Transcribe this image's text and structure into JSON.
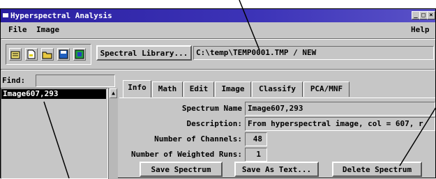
{
  "window": {
    "title": "Hyperspectral Analysis"
  },
  "title_buttons": [
    "_",
    "□",
    "×"
  ],
  "menu": {
    "file": "File",
    "image": "Image",
    "help": "Help"
  },
  "toolbar": {
    "icons": [
      "notebook-icon",
      "new-file-icon",
      "open-folder-icon",
      "save-disk-icon",
      "image-icon"
    ],
    "spectral_library_label": "Spectral Library...",
    "library_path": "C:\\temp\\TEMP0001.TMP / NEW"
  },
  "left_panel": {
    "find_label": "Find:",
    "find_value": "",
    "list_items": [
      "Image607,293"
    ]
  },
  "tabs": [
    "Info",
    "Math",
    "Edit",
    "Image",
    "Classify",
    "PCA/MNF"
  ],
  "info": {
    "spectrum_name_label": "Spectrum Name",
    "spectrum_name_value": "Image607,293",
    "description_label": "Description:",
    "description_value": "From hyperspectral image, col = 607, r",
    "channels_label": "Number of Channels:",
    "channels_value": "48",
    "weighted_runs_label": "Number of Weighted Runs:",
    "weighted_runs_value": "1"
  },
  "buttons": {
    "save_spectrum": "Save Spectrum",
    "save_as_text": "Save As Text...",
    "delete_spectrum": "Delete Spectrum"
  },
  "colors": {
    "titlebar": "#2a1fa0",
    "window_bg": "#c6c6c6",
    "selection_bg": "#000000",
    "selection_fg": "#ffffff"
  }
}
